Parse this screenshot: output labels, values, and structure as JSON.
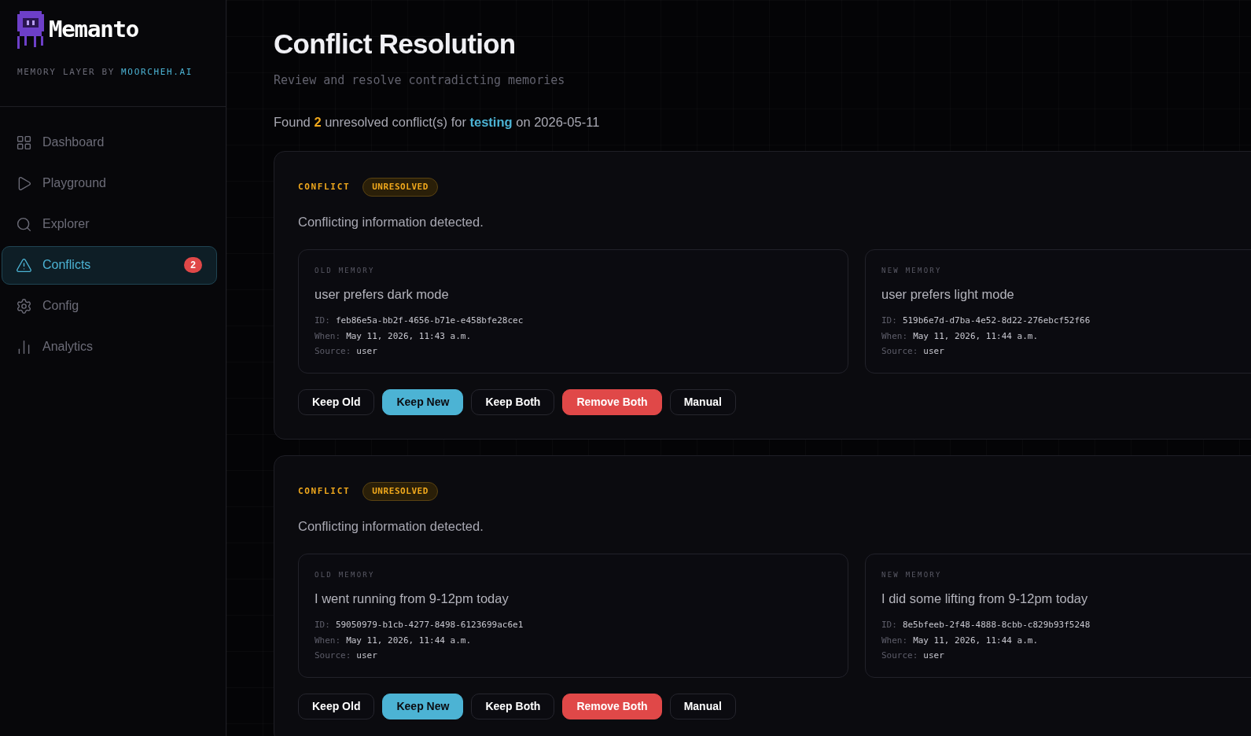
{
  "brand": {
    "name": "Memanto",
    "tagline": "MEMORY LAYER BY",
    "tagline_link": "MOORCHEH.AI"
  },
  "nav": [
    {
      "label": "Dashboard",
      "selected": false
    },
    {
      "label": "Playground",
      "selected": false
    },
    {
      "label": "Explorer",
      "selected": false
    },
    {
      "label": "Conflicts",
      "selected": true,
      "badge": "2"
    },
    {
      "label": "Config",
      "selected": false
    },
    {
      "label": "Analytics",
      "selected": false
    }
  ],
  "page": {
    "title": "Conflict Resolution",
    "subtitle": "Review and resolve contradicting memories"
  },
  "summary": {
    "prefix": "Found",
    "count": "2",
    "middle": "unresolved conflict(s) for",
    "project": "testing",
    "suffix": "on 2026-05-11"
  },
  "conflicts": [
    {
      "label": "CONFLICT",
      "status": "UNRESOLVED",
      "description": "Conflicting information detected.",
      "memories": [
        {
          "heading": "OLD MEMORY",
          "text": "user prefers dark mode",
          "id_label": "ID:",
          "id": "feb86e5a-bb2f-4656-b71e-e458bfe28cec",
          "when_label": "When:",
          "when": "May 11, 2026, 11:43 a.m.",
          "source_label": "Source:",
          "source": "user"
        },
        {
          "heading": "NEW MEMORY",
          "text": "user prefers light mode",
          "id_label": "ID:",
          "id": "519b6e7d-d7ba-4e52-8d22-276ebcf52f66",
          "when_label": "When:",
          "when": "May 11, 2026, 11:44 a.m.",
          "source_label": "Source:",
          "source": "user"
        }
      ],
      "actions": [
        {
          "label": "Keep Old",
          "kind": "default"
        },
        {
          "label": "Keep New",
          "kind": "primary"
        },
        {
          "label": "Keep Both",
          "kind": "default"
        },
        {
          "label": "Remove Both",
          "kind": "danger"
        },
        {
          "label": "Manual",
          "kind": "default"
        }
      ]
    },
    {
      "label": "CONFLICT",
      "status": "UNRESOLVED",
      "description": "Conflicting information detected.",
      "memories": [
        {
          "heading": "OLD MEMORY",
          "text": "I went running from 9-12pm today",
          "id_label": "ID:",
          "id": "59050979-b1cb-4277-8498-6123699ac6e1",
          "when_label": "When:",
          "when": "May 11, 2026, 11:44 a.m.",
          "source_label": "Source:",
          "source": "user"
        },
        {
          "heading": "NEW MEMORY",
          "text": "I did some lifting from 9-12pm today",
          "id_label": "ID:",
          "id": "8e5bfeeb-2f48-4888-8cbb-c829b93f5248",
          "when_label": "When:",
          "when": "May 11, 2026, 11:44 a.m.",
          "source_label": "Source:",
          "source": "user"
        }
      ],
      "actions": [
        {
          "label": "Keep Old",
          "kind": "default"
        },
        {
          "label": "Keep New",
          "kind": "primary"
        },
        {
          "label": "Keep Both",
          "kind": "default"
        },
        {
          "label": "Remove Both",
          "kind": "danger"
        },
        {
          "label": "Manual",
          "kind": "default"
        }
      ]
    }
  ]
}
